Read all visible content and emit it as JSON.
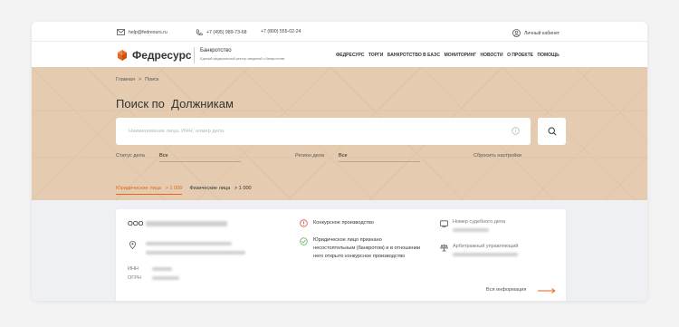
{
  "contacts": {
    "email": "help@fedresurs.ru",
    "phone1": "+7 (495) 989-73-68",
    "phone2": "+7 (800) 555-02-24",
    "cabinet": "Личный кабинет"
  },
  "header": {
    "logo": "Федресурс",
    "section_title": "Банкротство",
    "section_subtitle": "Единый федеральный реестр сведений о банкротстве",
    "nav": [
      "ФЕДРЕСУРС",
      "ТОРГИ",
      "БАНКРОТСТВО В ЕАЭС",
      "МОНИТОРИНГ",
      "НОВОСТИ",
      "О ПРОЕКТЕ",
      "ПОМОЩЬ"
    ]
  },
  "breadcrumb": {
    "home": "Главная",
    "separator": ">",
    "current": "Поиск"
  },
  "search": {
    "title": "Поиск по  Должникам",
    "placeholder": "Наименование лица, ИНН, номер дела",
    "status_label": "Статус дела",
    "status_value": "Все",
    "region_label": "Регион дела",
    "region_value": "Все",
    "reset": "Сбросить настройки"
  },
  "tabs": {
    "legal": "Юридические лица",
    "legal_count": "> 1 000",
    "physical": "Физические лица",
    "physical_count": "> 1 000"
  },
  "result": {
    "org_prefix": "ООО",
    "inn_label": "ИНН",
    "ogrn_label": "ОГРН",
    "status1": "Конкурсное производство",
    "status2": "Юридическое лицо признано несостоятельным (банкротом) и в отношении него открыто конкурсное производство",
    "case_label": "Номер судебного дела",
    "manager_label": "Арбитражный управляющий",
    "more": "Вся информация"
  },
  "colors": {
    "accent": "#e4661f",
    "band": "#e5ccb1",
    "success": "#6cb86c",
    "warning": "#e05b4b"
  }
}
